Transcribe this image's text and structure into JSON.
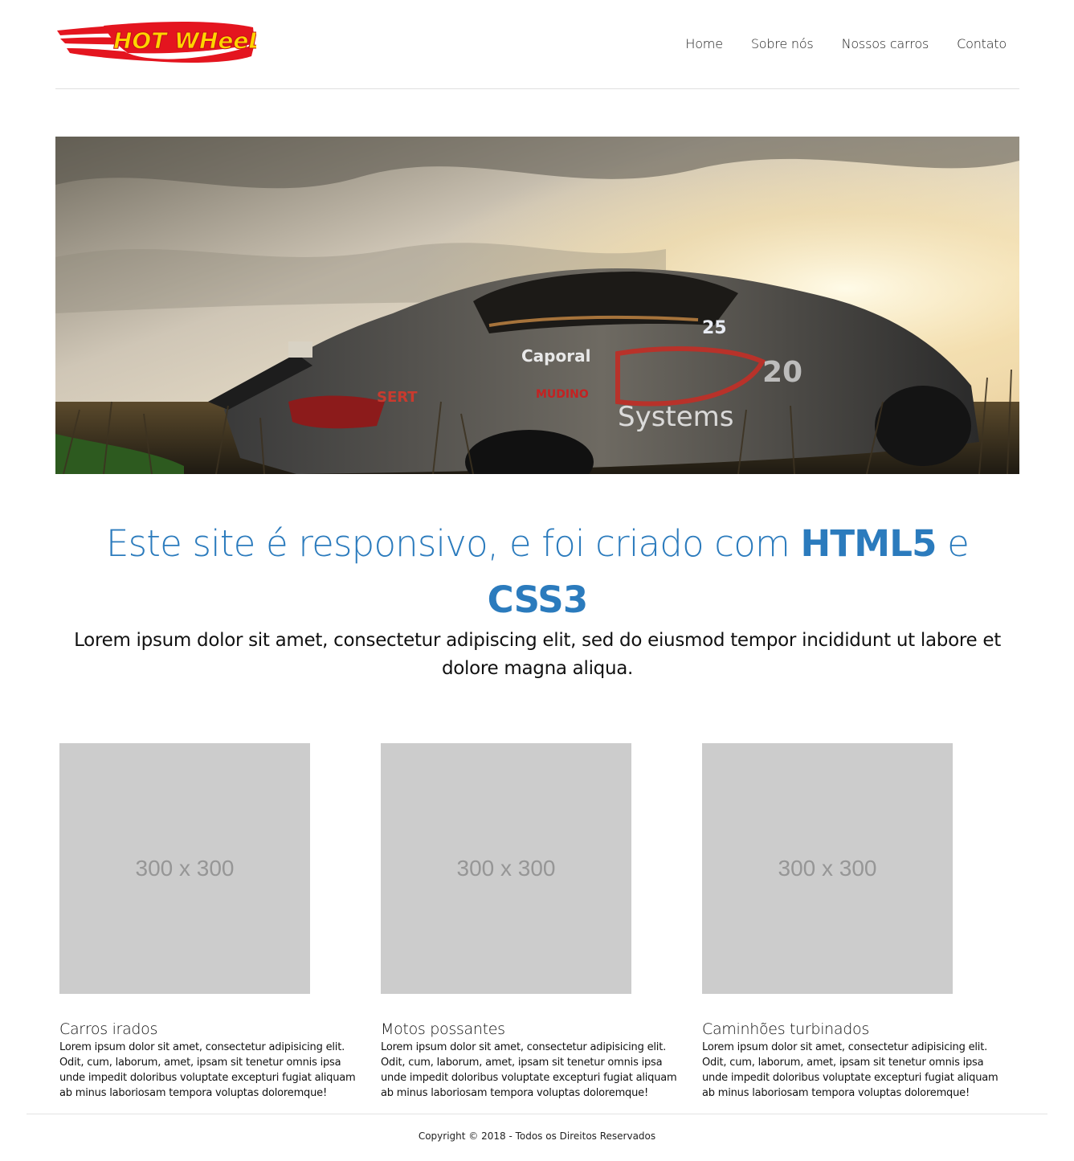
{
  "header": {
    "logo_text": "Hot Wheels",
    "nav": [
      {
        "label": "Home"
      },
      {
        "label": "Sobre nós"
      },
      {
        "label": "Nossos carros"
      },
      {
        "label": "Contato"
      }
    ]
  },
  "hero": {
    "image": "race-car-photo"
  },
  "intro": {
    "headline_part1": "Este site é responsivo, e foi criado com ",
    "headline_html5": "HTML5",
    "headline_part2": " e ",
    "headline_css3": "CSS3",
    "lead": "Lorem ipsum dolor sit amet, consectetur adipiscing elit, sed do eiusmod tempor incididunt ut labore et dolore magna aliqua."
  },
  "cards": [
    {
      "placeholder": "300 x 300",
      "title": "Carros irados",
      "text": "Lorem ipsum dolor sit amet, consectetur adipisicing elit. Odit, cum, laborum, amet, ipsam sit tenetur omnis ipsa unde impedit doloribus voluptate excepturi fugiat aliquam ab minus laboriosam tempora voluptas doloremque!"
    },
    {
      "placeholder": "300 x 300",
      "title": "Motos possantes",
      "text": "Lorem ipsum dolor sit amet, consectetur adipisicing elit. Odit, cum, laborum, amet, ipsam sit tenetur omnis ipsa unde impedit doloribus voluptate excepturi fugiat aliquam ab minus laboriosam tempora voluptas doloremque!"
    },
    {
      "placeholder": "300 x 300",
      "title": "Caminhões turbinados",
      "text": "Lorem ipsum dolor sit amet, consectetur adipisicing elit. Odit, cum, laborum, amet, ipsam sit tenetur omnis ipsa unde impedit doloribus voluptate excepturi fugiat aliquam ab minus laboriosam tempora voluptas doloremque!"
    }
  ],
  "footer": {
    "copyright": "Copyright © 2018 - Todos os Direitos Reservados"
  },
  "colors": {
    "accent": "#2b7bbd",
    "placeholder_bg": "#cccccc",
    "placeholder_text": "#969696",
    "logo_red": "#e4151f",
    "logo_yellow": "#ffd400"
  }
}
